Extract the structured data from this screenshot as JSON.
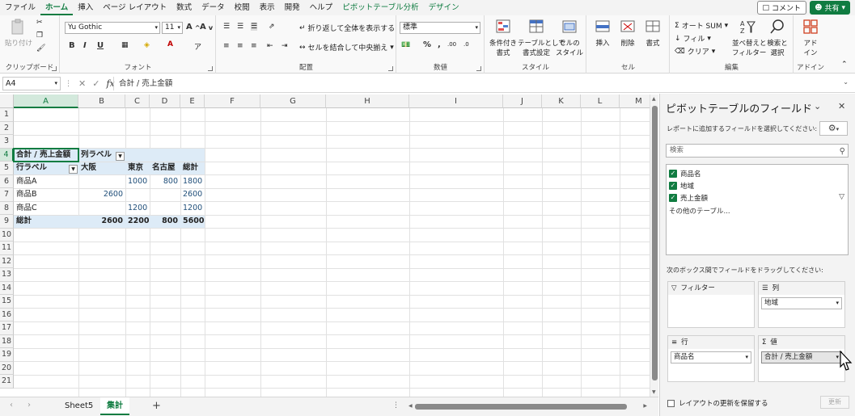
{
  "menu": {
    "items": [
      "ファイル",
      "ホーム",
      "挿入",
      "ページ レイアウト",
      "数式",
      "データ",
      "校閲",
      "表示",
      "開発",
      "ヘルプ",
      "ピボットテーブル分析",
      "デザイン"
    ],
    "active_index": 1,
    "comment_label": "コメント",
    "share_label": "共有"
  },
  "ribbon": {
    "clipboard": {
      "paste": "貼り付け",
      "label": "クリップボード"
    },
    "font": {
      "name": "Yu Gothic",
      "size": "11",
      "label": "フォント",
      "bold": "B",
      "italic": "I",
      "underline": "U"
    },
    "alignment": {
      "wrap": "折り返して全体を表示する",
      "merge": "セルを結合して中央揃え",
      "label": "配置"
    },
    "number": {
      "format": "標準",
      "label": "数値"
    },
    "styles": {
      "conditional": [
        "条件付き",
        "書式"
      ],
      "table": [
        "テーブルとして",
        "書式設定"
      ],
      "cell": [
        "セルの",
        "スタイル"
      ],
      "label": "スタイル"
    },
    "cells": {
      "insert": "挿入",
      "delete": "削除",
      "format": "書式",
      "label": "セル"
    },
    "editing": {
      "autosum": "オート SUM",
      "fill": "フィル",
      "clear": "クリア",
      "sort": [
        "並べ替えと",
        "フィルター"
      ],
      "find": [
        "検索と",
        "選択"
      ],
      "label": "編集"
    },
    "addins": {
      "btn": [
        "アド",
        "イン"
      ],
      "label": "アドイン"
    }
  },
  "formula_bar": {
    "name_box": "A4",
    "fx": "fx",
    "formula": "合計 / 売上金額"
  },
  "grid": {
    "columns": [
      "A",
      "B",
      "C",
      "D",
      "E",
      "F",
      "G",
      "H",
      "I",
      "J",
      "K",
      "L",
      "M"
    ],
    "rows": [
      "1",
      "2",
      "3",
      "4",
      "5",
      "6",
      "7",
      "8",
      "9",
      "10",
      "11",
      "12",
      "13",
      "14",
      "15",
      "16",
      "17",
      "18",
      "19",
      "20",
      "21"
    ],
    "pivot": {
      "value_header": "合計 / 売上金額",
      "col_label": "列ラベル",
      "row_label": "行ラベル",
      "col_items": [
        "大阪",
        "東京",
        "名古屋",
        "総計"
      ],
      "rows": [
        {
          "name": "商品A",
          "values": [
            "",
            "1000",
            "800",
            "1800"
          ]
        },
        {
          "name": "商品B",
          "values": [
            "2600",
            "",
            "",
            "2600"
          ]
        },
        {
          "name": "商品C",
          "values": [
            "",
            "1200",
            "",
            "1200"
          ]
        }
      ],
      "total": {
        "name": "総計",
        "values": [
          "2600",
          "2200",
          "800",
          "5600"
        ]
      }
    }
  },
  "sheets": {
    "tabs": [
      "Sheet5",
      "集計"
    ],
    "active": 1,
    "add": "+"
  },
  "pivot_pane": {
    "title": "ピボットテーブルのフィールド",
    "hint": "レポートに追加するフィールドを選択してください:",
    "search_placeholder": "検索",
    "fields": [
      "商品名",
      "地域",
      "売上金額"
    ],
    "more_tables": "その他のテーブル...",
    "area_hint": "次のボックス間でフィールドをドラッグしてください:",
    "areas": {
      "filter": {
        "title": "フィルター",
        "items": []
      },
      "columns": {
        "title": "列",
        "items": [
          "地域"
        ]
      },
      "rows": {
        "title": "行",
        "items": [
          "商品名"
        ]
      },
      "values": {
        "title": "値",
        "items": [
          "合計 / 売上金額"
        ]
      }
    },
    "defer_label": "レイアウトの更新を保留する",
    "update_label": "更新"
  }
}
